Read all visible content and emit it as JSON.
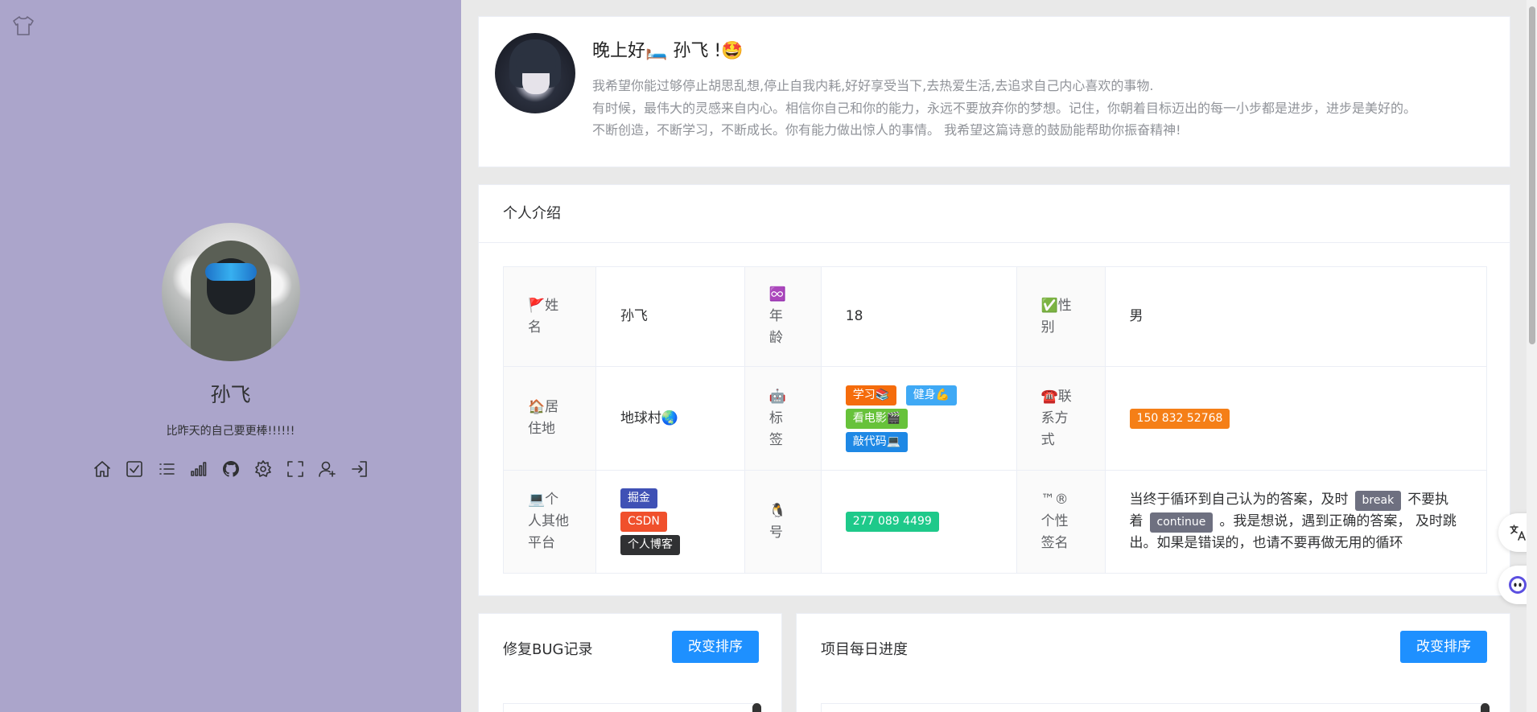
{
  "sidebar": {
    "name": "孙飞",
    "motto": "比昨天的自己要更棒!!!!!!",
    "icons": [
      "home-icon",
      "checkbox-icon",
      "list-icon",
      "signal-icon",
      "github-icon",
      "settings-icon",
      "fullscreen-icon",
      "user-add-icon",
      "logout-icon"
    ]
  },
  "greeting": {
    "title": "晚上好🛏️ 孙飞 !🤩",
    "lines": [
      "我希望你能过够停止胡思乱想,停止自我内耗,好好享受当下,去热爱生活,去追求自己内心喜欢的事物.",
      "有时候，最伟大的灵感来自内心。相信你自己和你的能力，永远不要放弃你的梦想。记住，你朝着目标迈出的每一小步都是进步，进步是美好的。",
      "不断创造，不断学习，不断成长。你有能力做出惊人的事情。 我希望这篇诗意的鼓励能帮助你振奋精神!"
    ]
  },
  "intro": {
    "header": "个人介绍",
    "name_label": "🚩姓名",
    "name_value": "孙飞",
    "age_label": "♾️年龄",
    "age_value": "18",
    "gender_label": "✅性别",
    "gender_value": "男",
    "home_label": "🏠居住地",
    "home_value": "地球村🌏",
    "tags_label": "🤖标签",
    "tags": [
      {
        "text": "学习📚",
        "color": "#f56c0c"
      },
      {
        "text": "健身💪",
        "color": "#3fa9f5"
      },
      {
        "text": "看电影🎬",
        "color": "#67c23a"
      },
      {
        "text": "敲代码💻",
        "color": "#1e88e5"
      }
    ],
    "contact_label": "☎️联系方式",
    "contact_value": "150 832 52768",
    "contact_color": "#f57f17",
    "platform_label": "💻个人其他平台",
    "platforms": [
      {
        "text": "掘金",
        "color": "#3f51b5"
      },
      {
        "text": "CSDN",
        "color": "#f0502c"
      },
      {
        "text": "个人博客",
        "color": "#303133"
      }
    ],
    "qq_label": "🐧号",
    "qq_value": "277 089 4499",
    "qq_color": "#1ec98a",
    "sign_label": "™®个性签名",
    "sign_part1": "当终于循环到自己认为的答案，及时",
    "sign_code1": "break",
    "sign_part2": "不要执着",
    "sign_code2": "continue",
    "sign_part3": "。我是想说，遇到正确的答案， 及时跳出。如果是错误的，也请不要再做无用的循环"
  },
  "bug_panel": {
    "title": "修复BUG记录",
    "button": "改变排序"
  },
  "progress_panel": {
    "title": "项目每日进度",
    "button": "改变排序"
  },
  "floating": [
    "translate-icon",
    "assistant-icon"
  ]
}
